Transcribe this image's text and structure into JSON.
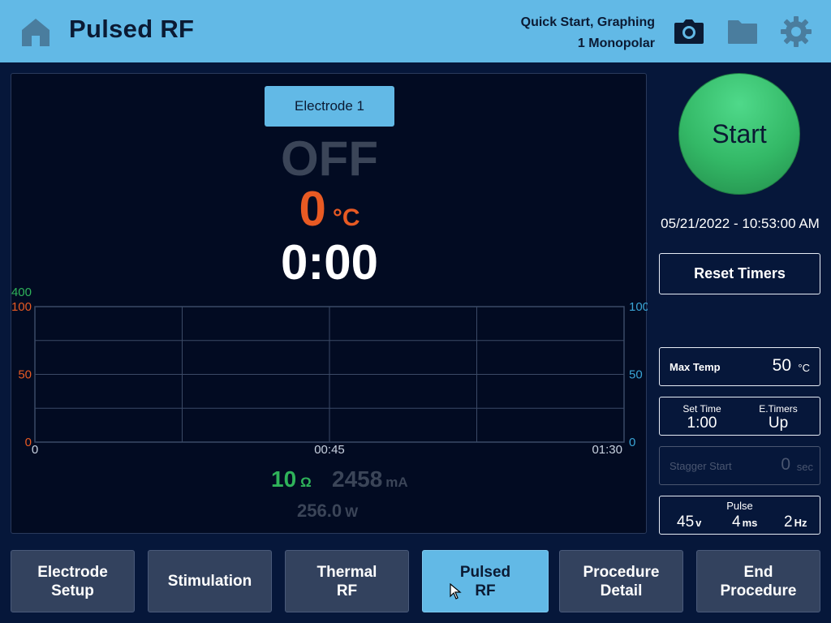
{
  "header": {
    "title": "Pulsed RF",
    "mode_line1": "Quick Start, Graphing",
    "mode_line2": "1 Monopolar",
    "icons": [
      "home-icon",
      "camera-icon",
      "folder-icon",
      "gear-icon"
    ]
  },
  "main": {
    "electrode_tab": "Electrode 1",
    "state": "OFF",
    "temperature": {
      "value": "0",
      "unit": "°C"
    },
    "timer": "0:00",
    "readouts": {
      "impedance": {
        "value": "10",
        "unit": "Ω"
      },
      "current": {
        "value": "2458",
        "unit": "mA"
      },
      "power": {
        "value": "256.0",
        "unit": "W"
      }
    }
  },
  "chart_data": {
    "type": "line",
    "title": "",
    "xlabel": "",
    "ylabel": "",
    "x_ticks": [
      "0",
      "00:45",
      "01:30"
    ],
    "left_axis_ticks_red": [
      "100",
      "50",
      "0"
    ],
    "left_axis_top_green": "400",
    "right_axis_ticks_blue": [
      "100",
      "50",
      "0"
    ],
    "ylim": [
      0,
      100
    ],
    "grid": true,
    "series": [],
    "colors": {
      "temperature": "#e85a23",
      "impedance": "#2fb35a",
      "right_axis": "#3aa5d6"
    }
  },
  "right": {
    "start_label": "Start",
    "datetime": "05/21/2022 - 10:53:00 AM",
    "reset_label": "Reset Timers",
    "max_temp": {
      "label": "Max Temp",
      "value": "50",
      "unit": "°C"
    },
    "set_time": {
      "label": "Set Time",
      "value": "1:00"
    },
    "e_timers": {
      "label": "E.Timers",
      "value": "Up"
    },
    "stagger": {
      "label": "Stagger Start",
      "value": "0",
      "unit": "sec"
    },
    "pulse": {
      "label": "Pulse",
      "voltage": {
        "value": "45",
        "unit": "v"
      },
      "width": {
        "value": "4",
        "unit": "ms"
      },
      "rate": {
        "value": "2",
        "unit": "Hz"
      }
    }
  },
  "nav": [
    {
      "label": "Electrode\nSetup",
      "active": false
    },
    {
      "label": "Stimulation",
      "active": false
    },
    {
      "label": "Thermal\nRF",
      "active": false
    },
    {
      "label": "Pulsed\nRF",
      "active": true
    },
    {
      "label": "Procedure\nDetail",
      "active": false
    },
    {
      "label": "End\nProcedure",
      "active": false
    }
  ],
  "colors": {
    "header_bg": "#62b9e6",
    "background": "#06173a",
    "accent_temp": "#e85a23",
    "accent_ohm": "#2fb35a",
    "start_green": "#33b866"
  }
}
